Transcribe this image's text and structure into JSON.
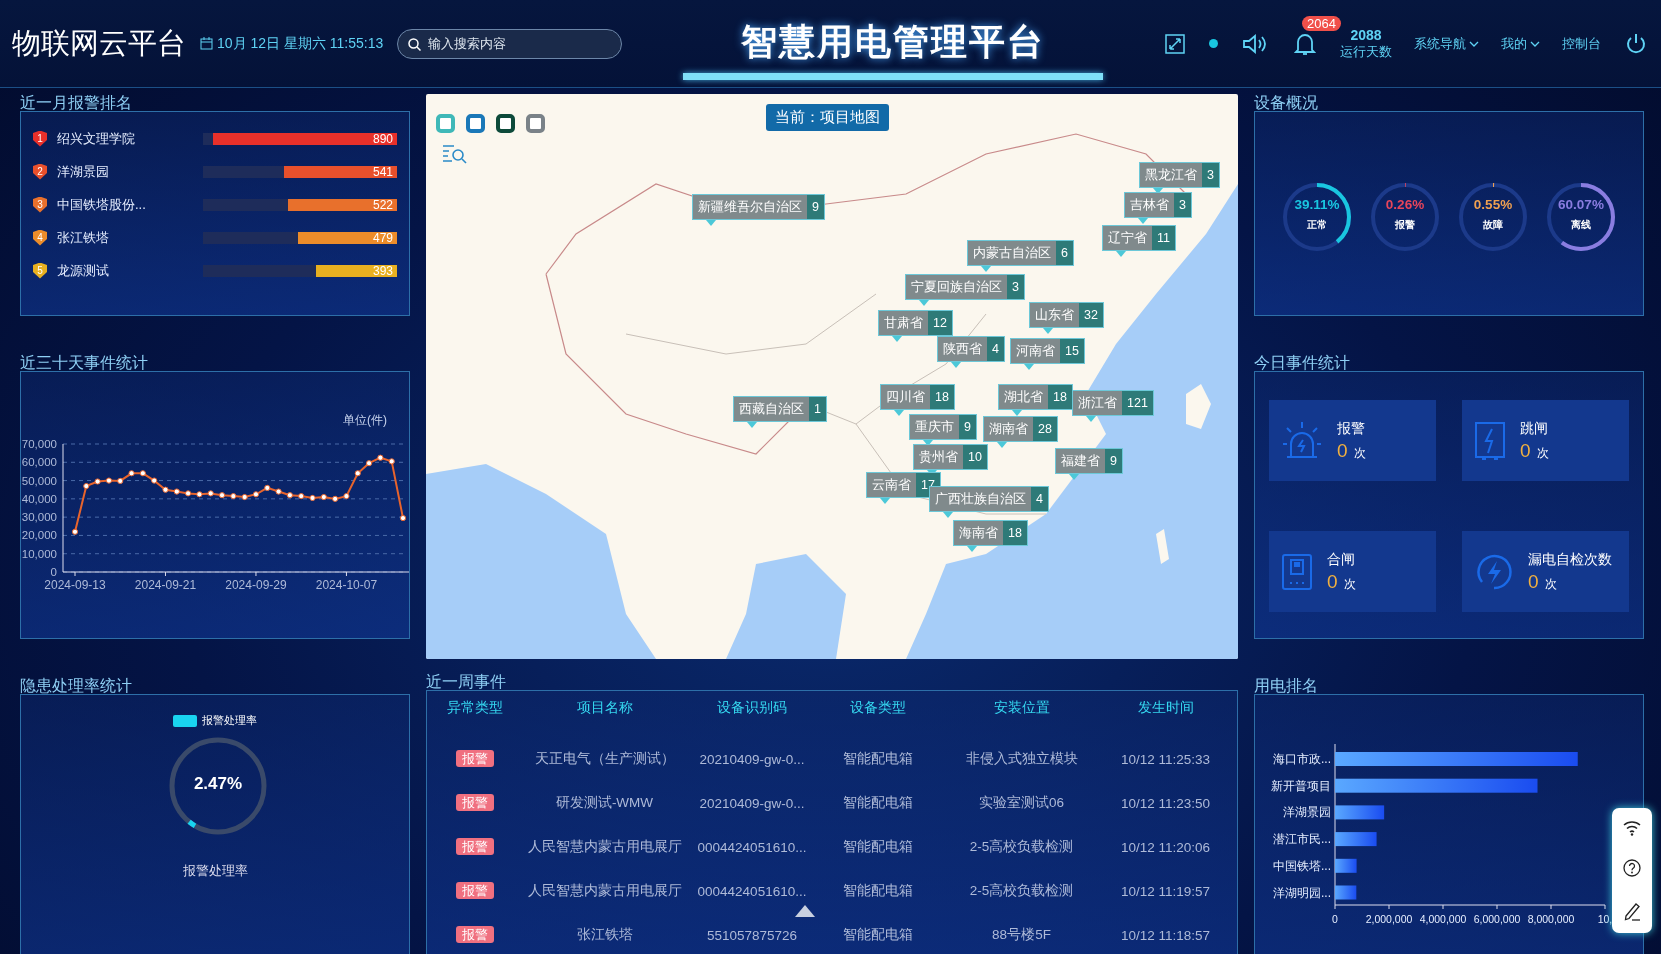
{
  "header": {
    "title": "物联网云平台",
    "datetime": "10月 12日 星期六 11:55:13",
    "search": {
      "placeholder": "输入搜索内容"
    },
    "center_title": "智慧用电管理平台",
    "notification_count": "2064",
    "run_days": {
      "value": "2088",
      "label": "运行天数"
    },
    "nav": [
      {
        "label": "系统导航",
        "dropdown": true
      },
      {
        "label": "我的",
        "dropdown": true
      },
      {
        "label": "控制台",
        "dropdown": false
      }
    ]
  },
  "alarm_ranking": {
    "title": "近一月报警排名",
    "rows": [
      {
        "rank": "1",
        "name": "绍兴文理学院",
        "value": "890",
        "level": 0.95
      },
      {
        "rank": "2",
        "name": "洋湖景园",
        "value": "541",
        "level": 0.58
      },
      {
        "rank": "3",
        "name": "中国铁塔股份...",
        "value": "522",
        "level": 0.56
      },
      {
        "rank": "4",
        "name": "张江铁塔",
        "value": "479",
        "level": 0.51
      },
      {
        "rank": "5",
        "name": "龙源测试",
        "value": "393",
        "level": 0.42
      }
    ]
  },
  "event_trend": {
    "title": "近三十天事件统计",
    "chart_data": {
      "type": "line",
      "ylabel": "单位(件)",
      "grid": true,
      "categories": [
        "2024-09-13",
        null,
        null,
        null,
        null,
        null,
        null,
        null,
        "2024-09-21",
        null,
        null,
        null,
        null,
        null,
        null,
        null,
        "2024-09-29",
        null,
        null,
        null,
        null,
        null,
        null,
        null,
        "2024-10-07",
        null,
        null,
        null,
        null,
        null
      ],
      "series": [
        {
          "color": "#e8642c",
          "marker": true,
          "values": [
            22000,
            47000,
            49500,
            50000,
            49800,
            54000,
            54000,
            50000,
            45000,
            44000,
            43000,
            42500,
            43000,
            42000,
            41500,
            41000,
            42500,
            46000,
            44000,
            42000,
            41500,
            40500,
            41000,
            40000,
            41500,
            54000,
            59500,
            62500,
            60500,
            29500
          ]
        }
      ],
      "ylim": [
        0,
        70000
      ],
      "yticks": [
        {
          "value": 0,
          "label": "0"
        },
        {
          "value": 10000,
          "label": "10,000"
        },
        {
          "value": 20000,
          "label": "20,000"
        },
        {
          "value": 30000,
          "label": "30,000"
        },
        {
          "value": 40000,
          "label": "40,000"
        },
        {
          "value": 50000,
          "label": "50,000"
        },
        {
          "value": 60000,
          "label": "60,000"
        },
        {
          "value": 70000,
          "label": "70,000"
        }
      ]
    }
  },
  "hazard_rate": {
    "title": "隐患处理率统计",
    "legend": "报警处理率",
    "value": "2.47%",
    "level": 0.0247,
    "caption": "报警处理率"
  },
  "map": {
    "current": "当前：项目地图",
    "layer_buttons": [
      {
        "color": "#3fb8b8"
      },
      {
        "color": "#1a78b8"
      },
      {
        "color": "#0d4a3a"
      },
      {
        "color": "#7a8288"
      }
    ],
    "markers": [
      {
        "name": "新疆维吾尔自治区",
        "count": "9"
      },
      {
        "name": "黑龙江省",
        "count": "3"
      },
      {
        "name": "吉林省",
        "count": "3"
      },
      {
        "name": "辽宁省",
        "count": "11"
      },
      {
        "name": "内蒙古自治区",
        "count": "6"
      },
      {
        "name": "宁夏回族自治区",
        "count": "3"
      },
      {
        "name": "山东省",
        "count": "32"
      },
      {
        "name": "甘肃省",
        "count": "12"
      },
      {
        "name": "陕西省",
        "count": "4"
      },
      {
        "name": "河南省",
        "count": "15"
      },
      {
        "name": "四川省",
        "count": "18"
      },
      {
        "name": "重庆市",
        "count": "9"
      },
      {
        "name": "西藏自治区",
        "count": "1"
      },
      {
        "name": "湖北省",
        "count": "18"
      },
      {
        "name": "浙江省",
        "count": "121"
      },
      {
        "name": "湖南省",
        "count": "28"
      },
      {
        "name": "贵州省",
        "count": "10"
      },
      {
        "name": "云南省",
        "count": "17"
      },
      {
        "name": "福建省",
        "count": "9"
      },
      {
        "name": "广西壮族自治区",
        "count": "4"
      },
      {
        "name": "海南省",
        "count": "18"
      }
    ]
  },
  "weekly_events": {
    "title": "近一周事件",
    "columns": [
      "异常类型",
      "项目名称",
      "设备识别码",
      "设备类型",
      "安装位置",
      "发生时间"
    ],
    "rows": [
      [
        "报警",
        "天正电气（生产测试）",
        "20210409-gw-0...",
        "智能配电箱",
        "非侵入式独立模块",
        "10/12 11:25:33"
      ],
      [
        "报警",
        "研发测试-WMW",
        "20210409-gw-0...",
        "智能配电箱",
        "实验室测试06",
        "10/12 11:23:50"
      ],
      [
        "报警",
        "人民智慧内蒙古用电展厅",
        "0004424051610...",
        "智能配电箱",
        "2-5高校负载检测",
        "10/12 11:20:06"
      ],
      [
        "报警",
        "人民智慧内蒙古用电展厅",
        "0004424051610...",
        "智能配电箱",
        "2-5高校负载检测",
        "10/12 11:19:57"
      ],
      [
        "报警",
        "张江铁塔",
        "551057875726",
        "智能配电箱",
        "88号楼5F",
        "10/12 11:18:57"
      ]
    ]
  },
  "device_overview": {
    "title": "设备概况",
    "rings": [
      {
        "value": "39.11%",
        "label": "正常",
        "level": 0.3911,
        "color": "#19c6e0"
      },
      {
        "value": "0.26%",
        "label": "报警",
        "level": 0.0026,
        "color": "#e8455a"
      },
      {
        "value": "0.55%",
        "label": "故障",
        "level": 0.0055,
        "color": "#f0a050"
      },
      {
        "value": "60.07%",
        "label": "离线",
        "level": 0.6007,
        "color": "#8a7de0"
      }
    ]
  },
  "today_events": {
    "title": "今日事件统计",
    "cards": [
      {
        "kind": "alarm",
        "label": "报警",
        "value": "0",
        "unit": "次"
      },
      {
        "kind": "trip",
        "label": "跳闸",
        "value": "0",
        "unit": "次"
      },
      {
        "kind": "close",
        "label": "合闸",
        "value": "0",
        "unit": "次"
      },
      {
        "kind": "leak_test",
        "label": "漏电自检次数",
        "value": "0",
        "unit": "次"
      }
    ]
  },
  "power_ranking": {
    "title": "用电排名",
    "chart_data": {
      "type": "bar",
      "orientation": "horizontal",
      "categories": [
        "海口市政...",
        "新开普项目",
        "洋湖景园",
        "潜江市民...",
        "中国铁塔...",
        "洋湖明园..."
      ],
      "values": [
        8990000,
        7500000,
        1820000,
        1540000,
        800000,
        790000
      ],
      "xticks": [
        {
          "value": 0,
          "label": "0"
        },
        {
          "value": 2000000,
          "label": "2,000,000"
        },
        {
          "value": 4000000,
          "label": "4,000,000"
        },
        {
          "value": 6000000,
          "label": "6,000,000"
        },
        {
          "value": 8000000,
          "label": "8,000,000"
        }
      ],
      "xlim": [
        0,
        10000000
      ]
    },
    "clipped_axis_label": "10,"
  }
}
